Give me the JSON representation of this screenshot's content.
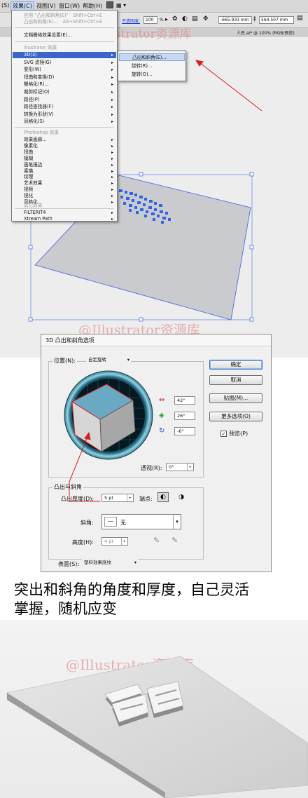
{
  "menubar": {
    "items": [
      "(S)",
      "效果(C)",
      "视图(V)",
      "窗口(W)",
      "帮助(H)"
    ]
  },
  "toolbar": {
    "opacity_label": "不透明度:",
    "opacity_value": "100",
    "percent": "%",
    "x_value": "-665.933 mm",
    "y_value": "564.507 mm",
    "doc_tab": "人民.ai* @ 100% (RGB/预览)"
  },
  "effect_menu": {
    "apply_last": "应用 \"凸出和斜角(E)\"",
    "apply_last_shortcut": "Shift+Ctrl+E",
    "last_effect": "凸出和斜角(E)...",
    "last_effect_shortcut": "Alt+Shift+Ctrl+E",
    "raster_settings": "文档栅格效果设置(E)...",
    "illustrator_header": "Illustrator 效果",
    "illustrator_items": [
      "3D(3)",
      "SVG 滤镜(G)",
      "变形(W)",
      "扭曲和变换(D)",
      "栅格化(R)...",
      "裁剪标记(O)",
      "路径(P)",
      "路径查找器(F)",
      "转换为形状(V)",
      "风格化(S)"
    ],
    "photoshop_header": "Photoshop 效果",
    "photoshop_items": [
      "效果画廊...",
      "像素化",
      "扭曲",
      "模糊",
      "画笔描边",
      "素描",
      "纹理",
      "艺术效果",
      "视频",
      "锐化",
      "风格化"
    ],
    "other_header": "其它效果",
    "other_items": [
      "FILTERIT4",
      "Xtream Path"
    ]
  },
  "submenu_3d": {
    "items": [
      "凸出和斜角(E)...",
      "绕转(R)...",
      "旋转(O)..."
    ]
  },
  "watermark": "@Illustrator资源库",
  "dialog": {
    "title": "3D 凸出和斜角选项",
    "position_label": "位置(N):",
    "position_value": "自定旋转",
    "rot_x": "42°",
    "rot_y": "26°",
    "rot_z": "-6°",
    "perspective_label": "透视(R):",
    "perspective_value": "0°",
    "extrude_group": "凸出与斜角",
    "extrude_depth_label": "凸出厚度(D):",
    "extrude_depth_value": "5 pt",
    "cap_label": "端点:",
    "bevel_label": "斜角:",
    "bevel_value": "无",
    "height_label": "高度(H):",
    "height_value": "4 pt",
    "surface_label": "表面(S):",
    "surface_value": "塑料效果底纹",
    "buttons": {
      "ok": "确定",
      "cancel": "取消",
      "map": "贴图(M)...",
      "more": "更多选项(O)",
      "preview": "预览(P)"
    }
  },
  "caption": {
    "line1": "突出和斜角的角度和厚度，自己灵活",
    "line2": "掌握，随机应变"
  },
  "colors": {
    "menu_highlight": "#3a66c9",
    "cube_top": "#6aa9c4",
    "cube_side": "#a7a7a7",
    "red_arrow": "#d42020"
  }
}
